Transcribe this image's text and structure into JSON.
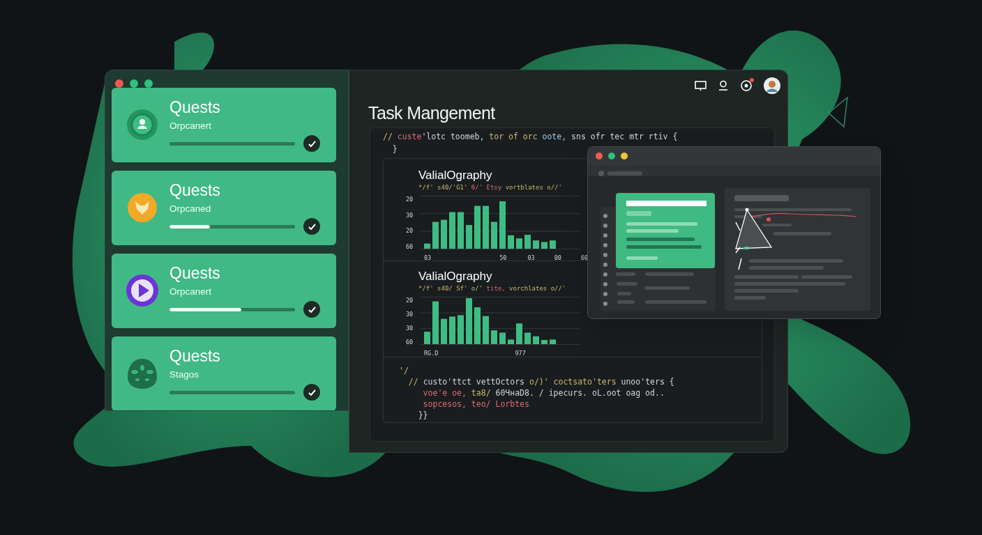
{
  "window": {
    "controls": [
      {
        "kind": "close"
      },
      {
        "kind": "minimize"
      },
      {
        "kind": "maximize"
      }
    ]
  },
  "quests": [
    {
      "title": "Quests",
      "subtitle": "Orpcanert",
      "level": 0,
      "done": true
    },
    {
      "title": "Quests",
      "subtitle": "Orpcaned",
      "level": 0.32,
      "done": true
    },
    {
      "title": "Quests",
      "subtitle": "Orpcanert",
      "level": 0.57,
      "done": true
    },
    {
      "title": "Quests",
      "subtitle": "Stagos",
      "level": 0,
      "done": true
    }
  ],
  "toolbar": {
    "notification": true
  },
  "title": "Task Mangement",
  "code_top": [
    [
      {
        "kind": "comment",
        "text": "//"
      },
      {
        "kind": "keyword",
        "text": " custe"
      },
      {
        "kind": "plain",
        "text": "'lotc toomeb, "
      },
      {
        "kind": "comment",
        "text": "tor of orc "
      },
      {
        "kind": "type",
        "text": "oote, "
      },
      {
        "kind": "plain",
        "text": "sns ofr tec mtr rtiv {"
      }
    ],
    [
      {
        "kind": "plain",
        "text": "  }"
      }
    ]
  ],
  "charts": [
    {
      "title": "ValialOgraphy",
      "subtitle": [
        {
          "kind": "comment",
          "text": "*/f' s40/'G1' "
        },
        {
          "kind": "keyword",
          "text": "б/' Etsy "
        },
        {
          "kind": "comment",
          "text": "vortblates o//'"
        }
      ],
      "yticks": [
        "20",
        "30",
        "20",
        "60"
      ],
      "xticks": [
        "03",
        "50",
        "03",
        "00",
        "60"
      ]
    },
    {
      "title": "ValialOgraphy",
      "subtitle": [
        {
          "kind": "comment",
          "text": "*/f' s40/ Sf' o/' "
        },
        {
          "kind": "keyword",
          "text": "tite, "
        },
        {
          "kind": "comment",
          "text": "vorchlates o//'"
        }
      ],
      "yticks": [
        "20",
        "30",
        "30",
        "60"
      ],
      "xticks": [
        "RG.D",
        "977"
      ]
    }
  ],
  "code_bottom": [
    [
      {
        "kind": "comment",
        "text": "'/"
      }
    ],
    [
      {
        "kind": "comment",
        "text": "  // "
      },
      {
        "kind": "plain",
        "text": "custo'ttct vettOctors "
      },
      {
        "kind": "comment",
        "text": "o/)' coctsato'ters "
      },
      {
        "kind": "plain",
        "text": "unoo'ters {"
      }
    ],
    [
      {
        "kind": "keyword",
        "text": "     voe'e oe, "
      },
      {
        "kind": "comment",
        "text": "ta8/ "
      },
      {
        "kind": "plain",
        "text": "60ЧнаD8. / ipecurs. oL.oot oag od.."
      }
    ],
    [
      {
        "kind": "keyword",
        "text": "     sopcesos, teo/ Lorbtes"
      }
    ],
    [
      {
        "kind": "plain",
        "text": "    }}"
      }
    ]
  ],
  "preview": {
    "controls": [
      {
        "kind": "close"
      },
      {
        "kind": "minimize"
      },
      {
        "kind": "zoom"
      }
    ]
  }
}
